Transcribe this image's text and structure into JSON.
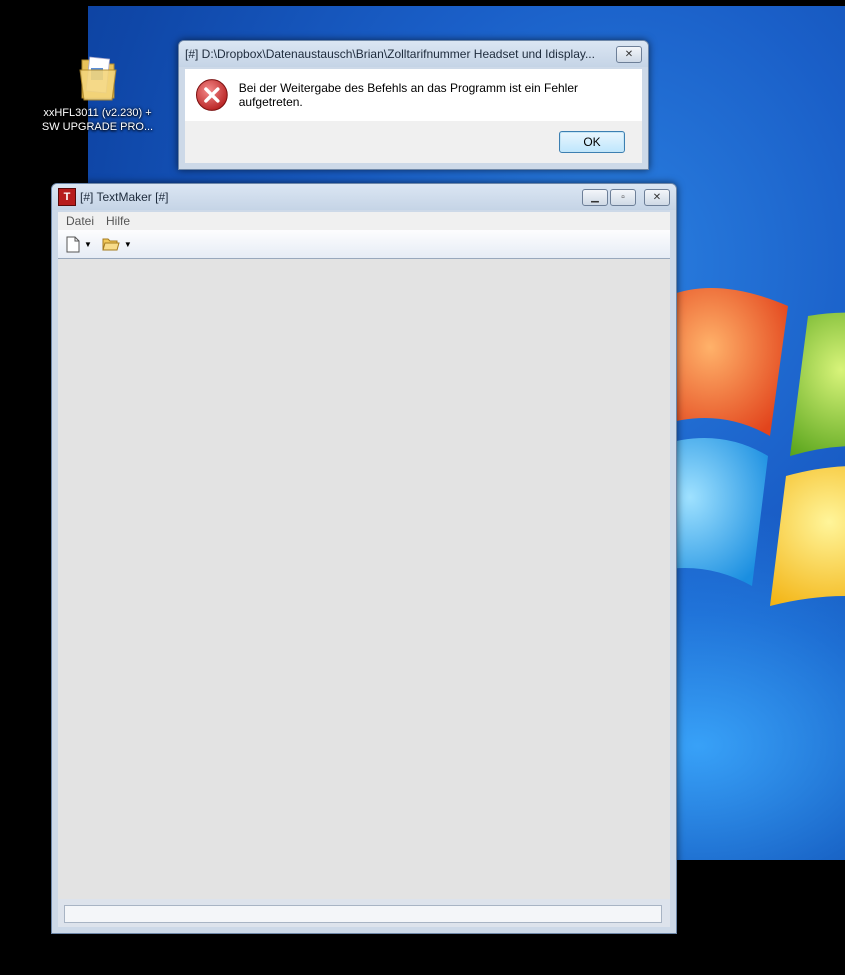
{
  "desktop": {
    "icon": {
      "name": "folder-icon",
      "label_line1": "xxHFL3011 (v2.230) +",
      "label_line2": "SW UPGRADE PRO..."
    }
  },
  "error_dialog": {
    "title": "[#] D:\\Dropbox\\Datenaustausch\\Brian\\Zolltarifnummer Headset und Idisplay...",
    "message": "Bei der Weitergabe des Befehls an das Programm ist ein Fehler aufgetreten.",
    "close_glyph": "✕",
    "ok_label": "OK"
  },
  "textmaker": {
    "title": "[#] TextMaker [#]",
    "app_icon_letter": "T",
    "minimize_glyph": "▁",
    "maximize_glyph": "▫",
    "close_glyph": "✕",
    "menu": [
      "Datei",
      "Hilfe"
    ]
  },
  "colors": {
    "error_red": "#c8282b",
    "app_icon_red": "#b71c1c",
    "desktop_blue": "#1a5fc8"
  }
}
